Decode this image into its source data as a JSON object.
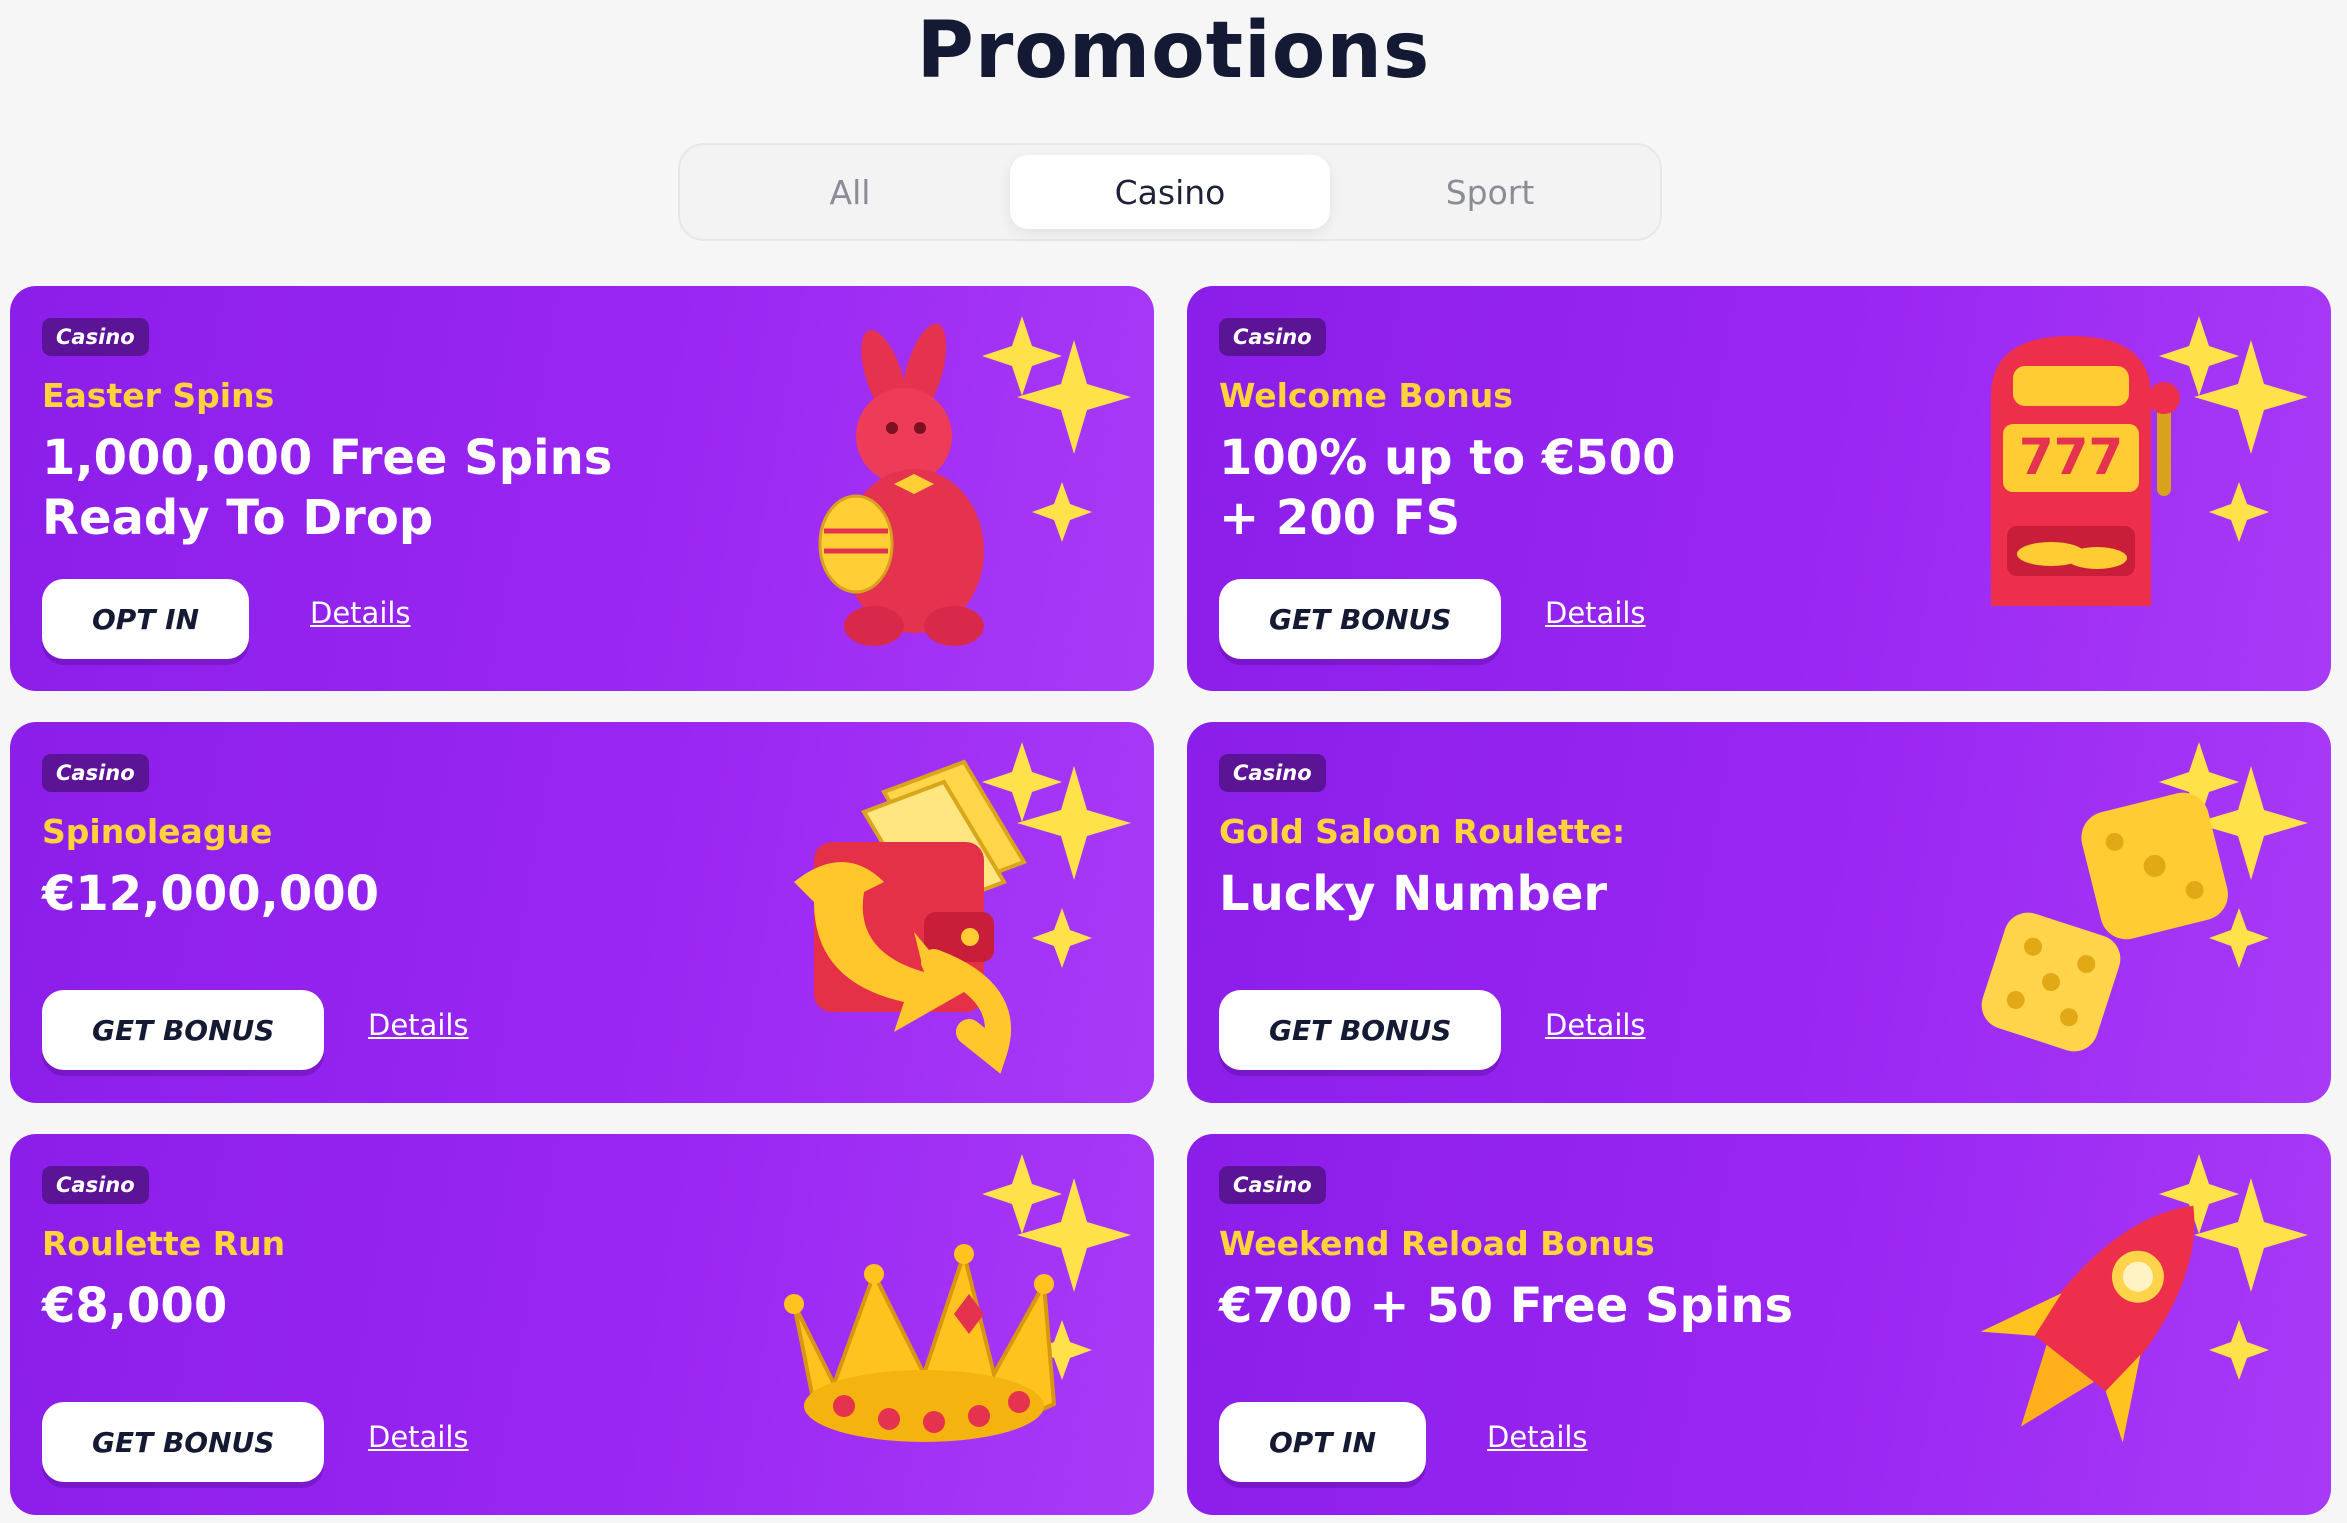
{
  "header": {
    "title": "Promotions"
  },
  "tabs": [
    {
      "label": "All",
      "active": false
    },
    {
      "label": "Casino",
      "active": true
    },
    {
      "label": "Sport",
      "active": false
    }
  ],
  "colors": {
    "card_purple": "#9a26f2",
    "badge_bg": "#5a1495",
    "subtitle_yellow": "#ffd43b",
    "title_navy": "#141a33"
  },
  "promotions": [
    {
      "badge": "Casino",
      "subtitle": "Easter Spins",
      "headline": "1,000,000 Free Spins Ready To Drop",
      "cta": "OPT IN",
      "details": "Details",
      "icon": "bunny-easter-egg-icon"
    },
    {
      "badge": "Casino",
      "subtitle": "Welcome Bonus",
      "headline": "100% up to €500 + 200 FS",
      "cta": "GET BONUS",
      "details": "Details",
      "icon": "slot-machine-icon"
    },
    {
      "badge": "Casino",
      "subtitle": "Spinoleague",
      "headline": "€12,000,000",
      "cta": "GET BONUS",
      "details": "Details",
      "icon": "wallet-icon"
    },
    {
      "badge": "Casino",
      "subtitle": "Gold Saloon Roulette:",
      "headline": "Lucky Number",
      "cta": "GET BONUS",
      "details": "Details",
      "icon": "dice-icon"
    },
    {
      "badge": "Casino",
      "subtitle": "Roulette Run",
      "headline": "€8,000",
      "cta": "GET BONUS",
      "details": "Details",
      "icon": "crown-icon"
    },
    {
      "badge": "Casino",
      "subtitle": "Weekend Reload Bonus",
      "headline": "€700 + 50 Free Spins",
      "cta": "OPT IN",
      "details": "Details",
      "icon": "rocket-icon"
    }
  ]
}
